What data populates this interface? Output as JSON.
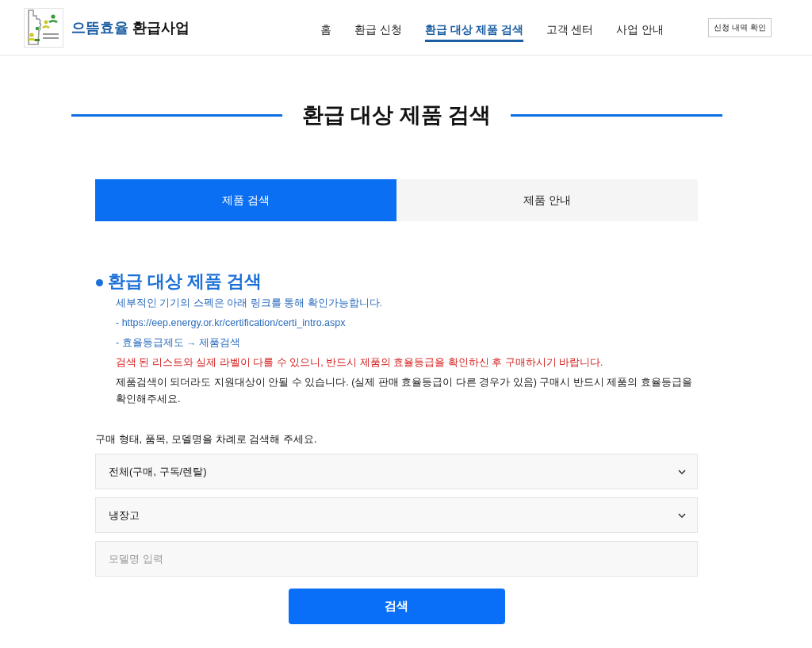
{
  "header": {
    "brand": {
      "accent": "으뜸효율",
      "name": "환급사업"
    },
    "nav": [
      {
        "label": "홈",
        "selected": false
      },
      {
        "label": "환급 신청",
        "selected": false
      },
      {
        "label": "환급 대상 제품 검색",
        "selected": true
      },
      {
        "label": "고객 센터",
        "selected": false
      },
      {
        "label": "사업 안내",
        "selected": false
      }
    ],
    "history_button": "신청 내역 확인"
  },
  "page_title": "환급 대상 제품 검색",
  "tabs": [
    {
      "label": "제품 검색",
      "selected": true
    },
    {
      "label": "제품 안내",
      "selected": false
    }
  ],
  "section": {
    "title": "환급 대상 제품 검색",
    "notes": [
      {
        "kind": "info",
        "text": "세부적인 기기의 스펙은 아래 링크를 통해 확인가능합니다."
      },
      {
        "kind": "info",
        "text": "- https://eep.energy.or.kr/certification/certi_intro.aspx"
      },
      {
        "kind": "info",
        "text": "- 효율등급제도 → 제품검색"
      },
      {
        "kind": "warning",
        "text": "검색 된 리스트와 실제 라벨이 다를 수 있으니, 반드시 제품의 효율등급을 확인하신 후 구매하시기 바랍니다."
      },
      {
        "kind": "plain",
        "text": "제품검색이 되더라도 지원대상이 안될 수 있습니다. (실제 판매 효율등급이 다른 경우가 있음) 구매시 반드시 제품의 효율등급을 확인해주세요."
      }
    ]
  },
  "search_form": {
    "instruction": "구매 형태, 품목, 모델명을 차례로 검색해 주세요.",
    "selects": [
      {
        "value": "전체(구매, 구독/렌탈)"
      },
      {
        "value": "냉장고"
      }
    ],
    "model_field": {
      "placeholder": "모델명 입력"
    },
    "submit": "검색"
  }
}
